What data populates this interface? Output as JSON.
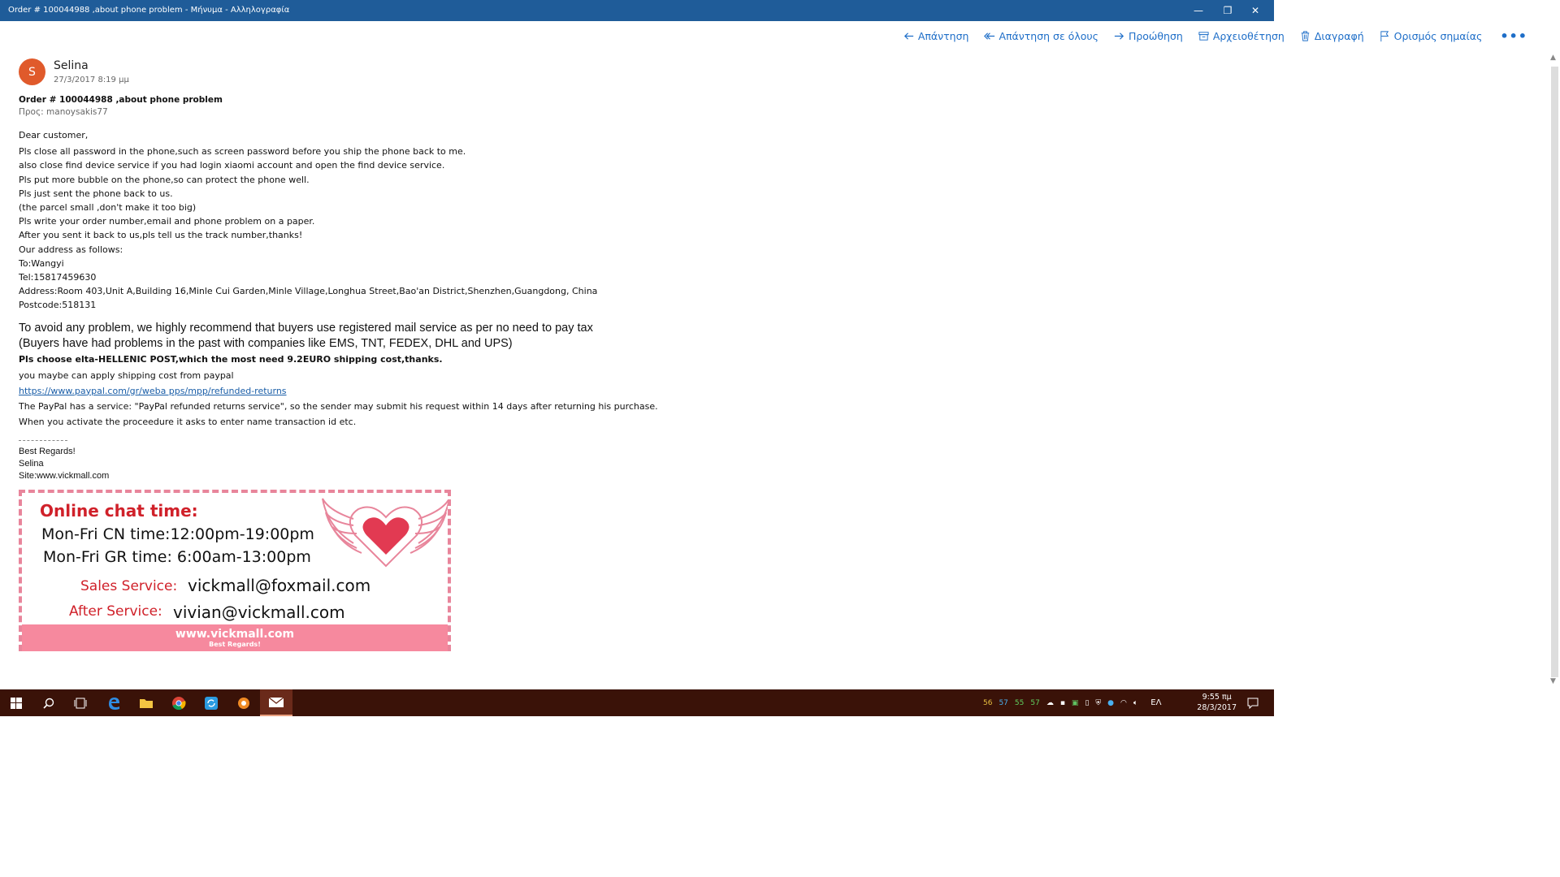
{
  "window": {
    "title": "Order # 100044988 ,about phone problem - Μήνυμα - Αλληλογραφία",
    "minimize": "—",
    "restore": "❐",
    "close": "✕"
  },
  "actions": {
    "reply": "Απάντηση",
    "reply_all": "Απάντηση σε όλους",
    "forward": "Προώθηση",
    "archive": "Αρχειοθέτηση",
    "delete": "Διαγραφή",
    "flag": "Ορισμός σημαίας",
    "more": "•••"
  },
  "message": {
    "avatar_initial": "S",
    "avatar_color": "#e05a2b",
    "sender": "Selina",
    "date": "27/3/2017 8:19 μμ",
    "subject": "Order # 100044988 ,about phone problem",
    "to_label": "Προς:",
    "to": "manoysakis77"
  },
  "body": {
    "greeting": "Dear customer,",
    "lines": [
      "Pls close all password in the phone,such as screen password before you ship the phone back to me.",
      "also close find device service if you had login xiaomi account and open the find device service.",
      "Pls put more bubble on the phone,so can protect the phone well.",
      "Pls just sent the phone back to us.",
      "(the parcel small ,don't make it too big)",
      "Pls write your order number,email and phone problem on a paper.",
      "After you sent it back to us,pls tell us the track number,thanks!",
      "Our address as follows:",
      "To:Wangyi",
      "Tel:15817459630",
      "Address:Room 403,Unit A,Building 16,Minle Cui Garden,Minle Village,Longhua Street,Bao'an District,Shenzhen,Guangdong, China",
      "Postcode:518131"
    ],
    "big1": "To avoid any problem, we highly recommend that buyers use registered mail service as per no need to pay tax",
    "big2": "(Buyers have had problems in the past with companies like EMS, TNT, FEDEX, DHL and UPS)",
    "bold": "Pls choose elta-HELLENIC POST,which the most need 9.2EURO shipping cost,thanks.",
    "paypal_note": "you maybe can apply shipping cost from paypal",
    "link": "https://www.paypal.com/gr/weba pps/mpp/refunded-returns",
    "service": "The PayPal has a service: \"PayPal refunded returns service\", so the sender may submit his request within 14 days after returning his purchase.",
    "activate": "When you activate the proceedure it asks to enter name transaction id etc."
  },
  "signature": {
    "regards": "Best Regards!",
    "name": "Selina",
    "site": "Site:www.vickmall.com"
  },
  "banner": {
    "heading": "Online chat time:",
    "cn_time": "Mon-Fri CN time:12:00pm-19:00pm",
    "gr_time": "Mon-Fri GR time:  6:00am-13:00pm",
    "sales_label": "Sales Service:",
    "sales_email": "vickmall@foxmail.com",
    "after_label": "After Service:",
    "after_email": "vivian@vickmall.com",
    "footer_url": "www.vickmall.com",
    "footer_regards": "Best Regards!",
    "accent": "#d0212a",
    "pink": "#f6899e"
  },
  "taskbar": {
    "tray_numbers": [
      "56",
      "57",
      "55",
      "57"
    ],
    "language": "ΕΛ",
    "time": "9:55 πμ",
    "date": "28/3/2017"
  }
}
